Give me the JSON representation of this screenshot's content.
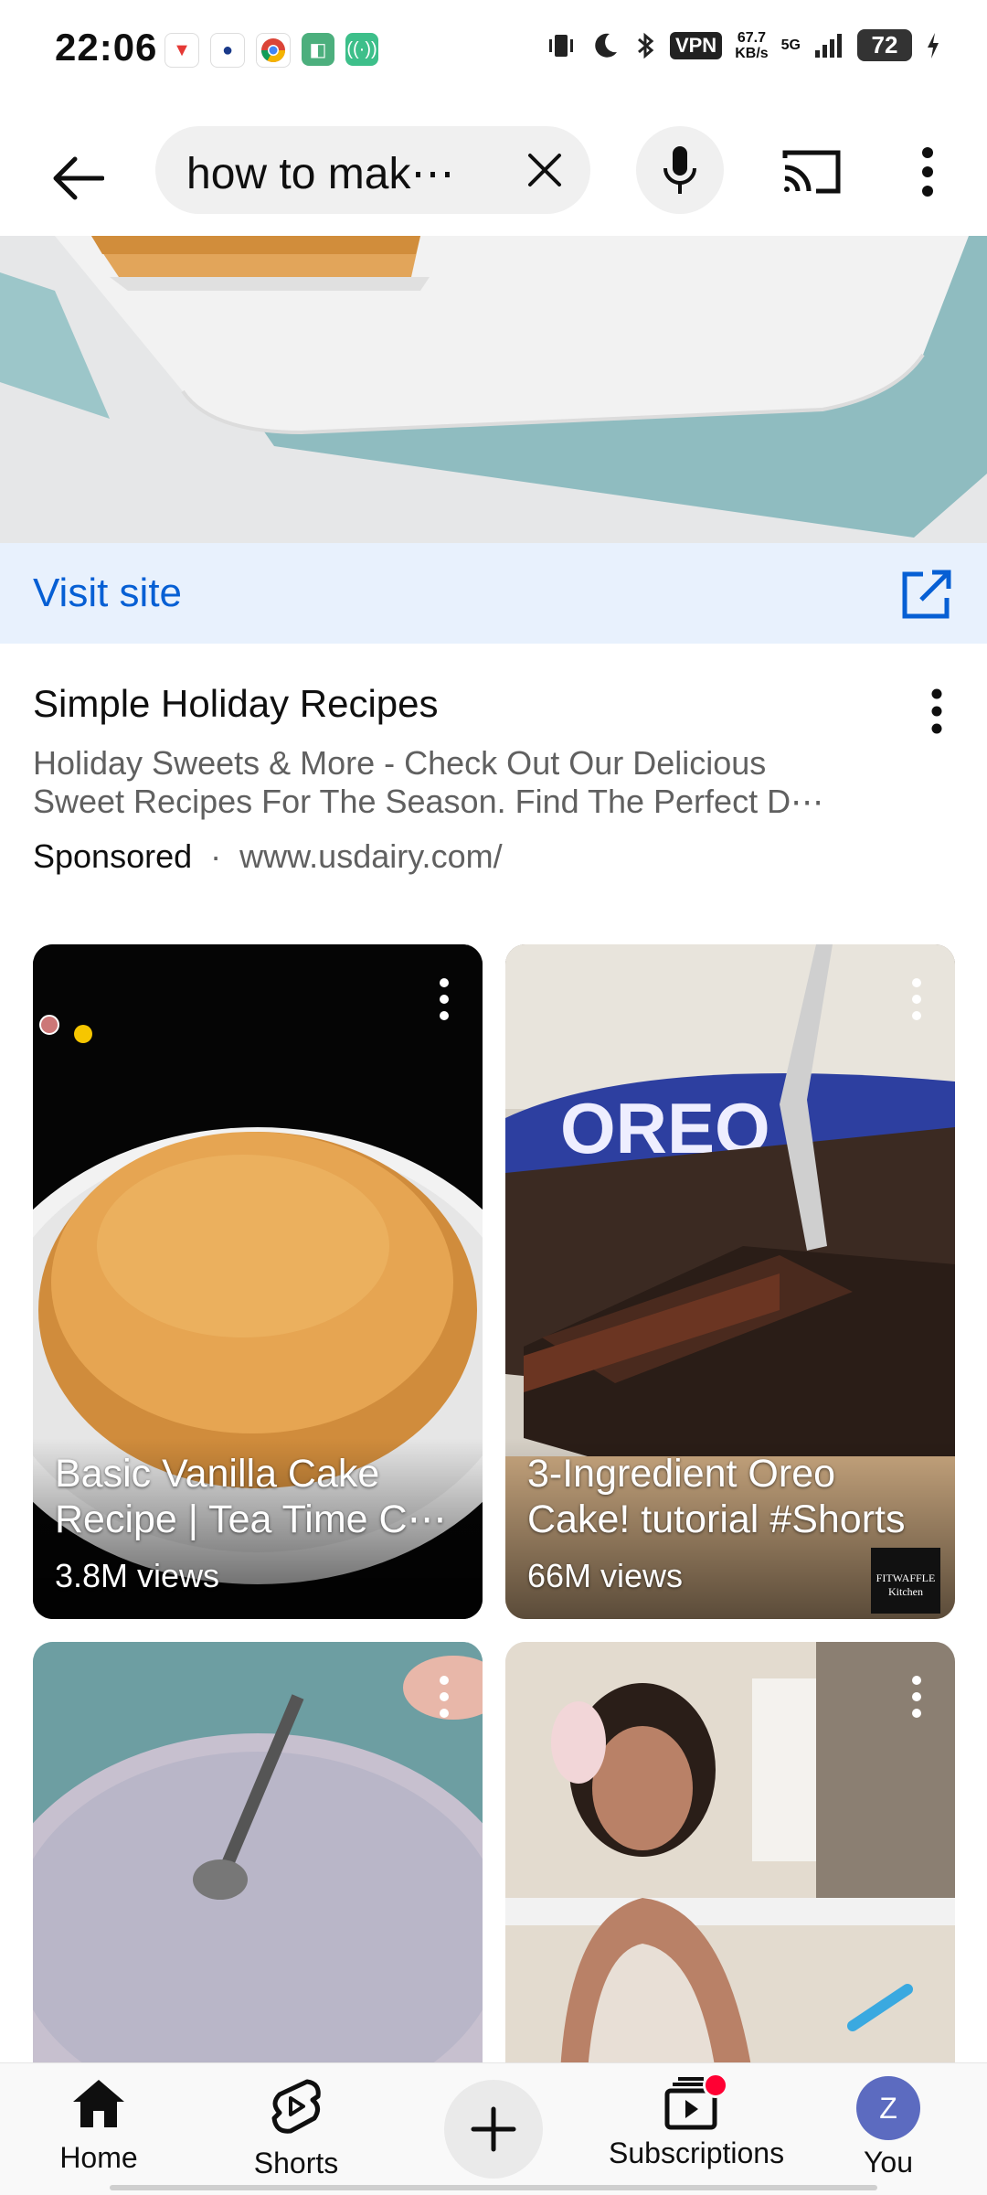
{
  "status_bar": {
    "time": "22:06",
    "vpn": "VPN",
    "speed_value": "67.7",
    "speed_unit": "KB/s",
    "network": "5G",
    "battery": "72"
  },
  "search": {
    "query": "how to mak⋯"
  },
  "ad": {
    "visit_label": "Visit site",
    "title": "Simple Holiday Recipes",
    "description": "Holiday Sweets & More - Check Out Our Delicious Sweet Recipes For The Season. Find The Perfect D⋯",
    "sponsored": "Sponsored",
    "separator": "·",
    "url": "www.usdairy.com/"
  },
  "shorts": [
    {
      "title": "Basic Vanilla Cake Recipe | Tea Time C⋯",
      "views": "3.8M views"
    },
    {
      "title": "3-Ingredient Oreo Cake! tutorial #Shorts",
      "views": "66M views",
      "brand": "FITWAFFLE Kitchen"
    },
    {
      "title": "",
      "views": ""
    },
    {
      "title": "",
      "views": ""
    }
  ],
  "oreo_label": "OREO",
  "bottom_nav": {
    "home": "Home",
    "shorts": "Shorts",
    "subscriptions": "Subscriptions",
    "you": "You",
    "avatar_letter": "Z"
  },
  "colors": {
    "accent_blue": "#065fd4",
    "visit_bg": "#e8f1fd",
    "notification_red": "#ff0033"
  }
}
